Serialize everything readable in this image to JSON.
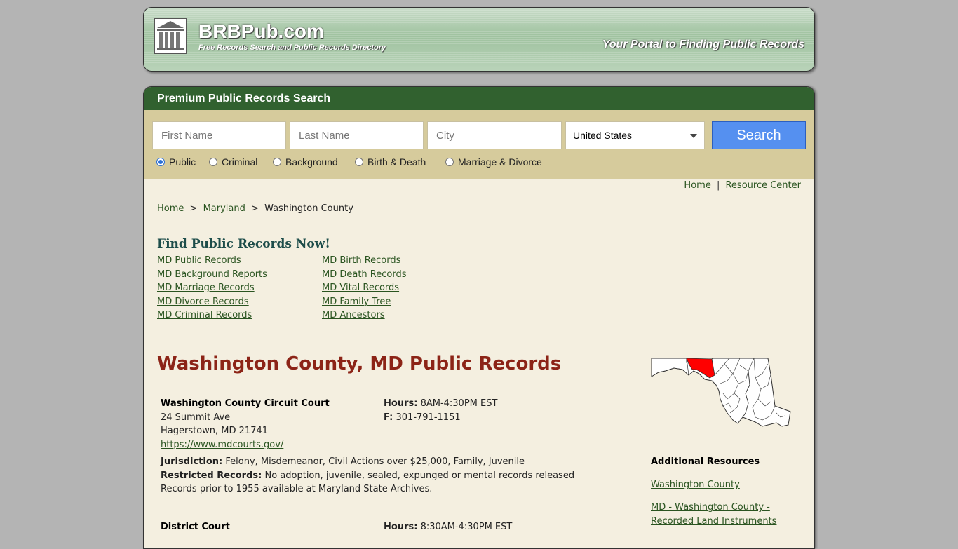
{
  "header": {
    "brand": "BRBPub.com",
    "subtitle": "Free Records Search and Public Records Directory",
    "tagline": "Your Portal to Finding Public Records",
    "logo_icon": "courthouse-columns-icon"
  },
  "search": {
    "title": "Premium Public Records Search",
    "first_name_placeholder": "First Name",
    "last_name_placeholder": "Last Name",
    "city_placeholder": "City",
    "country_selected": "United States",
    "button_label": "Search",
    "radio_options": [
      "Public",
      "Criminal",
      "Background",
      "Birth & Death",
      "Marriage & Divorce"
    ],
    "radio_selected": "Public"
  },
  "top_links": {
    "home": "Home",
    "separator": "|",
    "resource_center": "Resource Center"
  },
  "breadcrumb": {
    "home": "Home",
    "sep": ">",
    "state": "Maryland",
    "current": "Washington County"
  },
  "find": {
    "title": "Find Public Records Now!",
    "left": [
      "MD Public Records",
      "MD Background Reports",
      "MD Marriage Records",
      "MD Divorce Records",
      "MD Criminal Records"
    ],
    "right": [
      "MD Birth Records",
      "MD Death Records",
      "MD Vital Records",
      "MD Family Tree",
      "MD Ancestors"
    ]
  },
  "county": {
    "title": "Washington County, MD Public Records"
  },
  "courts": [
    {
      "name": "Washington County Circuit Court",
      "address1": "24 Summit Ave",
      "address2": "Hagerstown, MD 21741",
      "url": "https://www.mdcourts.gov/",
      "hours_label": "Hours:",
      "hours": "8AM-4:30PM EST",
      "fax_label": "F:",
      "fax": "301-791-1151",
      "jurisdiction_label": "Jurisdiction:",
      "jurisdiction": "Felony, Misdemeanor, Civil Actions over $25,000, Family, Juvenile",
      "restricted_label": "Restricted Records:",
      "restricted": "No adoption, juvenile, sealed, expunged or mental records released",
      "note": "Records prior to 1955 available at Maryland State Archives."
    },
    {
      "name": "District Court",
      "hours_label": "Hours:",
      "hours": "8:30AM-4:30PM EST"
    }
  ],
  "map": {
    "highlight_color": "#ff0000",
    "alt": "maryland-map-icon"
  },
  "additional": {
    "title": "Additional Resources",
    "links": [
      "Washington County",
      "MD - Washington County -",
      "Recorded Land Instruments"
    ]
  }
}
